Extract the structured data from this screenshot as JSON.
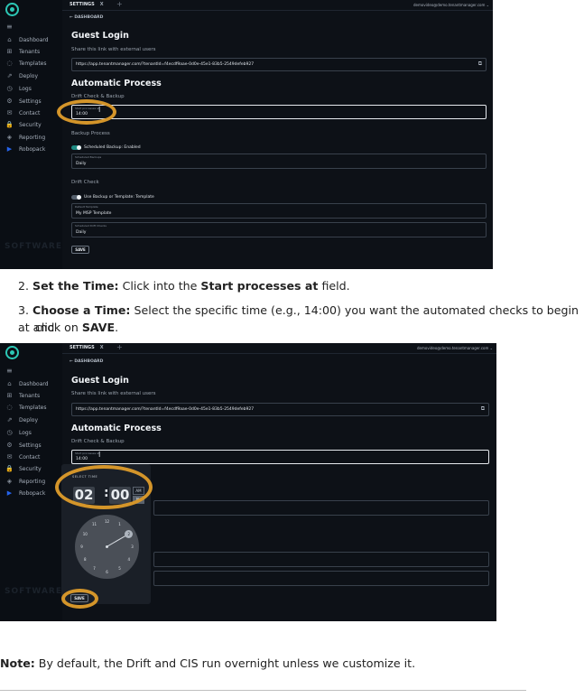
{
  "screenshot1": {
    "sidebar": {
      "brand": "SOFTWARE",
      "items": [
        {
          "label": "Dashboard",
          "icon": "home-icon",
          "glyph": "⌂"
        },
        {
          "label": "Tenants",
          "icon": "plus-square-icon",
          "glyph": "⊞"
        },
        {
          "label": "Templates",
          "icon": "template-icon",
          "glyph": "◌"
        },
        {
          "label": "Deploy",
          "icon": "deploy-icon",
          "glyph": "⇗"
        },
        {
          "label": "Logs",
          "icon": "logs-icon",
          "glyph": "◷"
        },
        {
          "label": "Settings",
          "icon": "gear-icon",
          "glyph": "⚙"
        },
        {
          "label": "Contact",
          "icon": "mail-icon",
          "glyph": "✉"
        },
        {
          "label": "Security",
          "icon": "lock-icon",
          "glyph": "🔒"
        },
        {
          "label": "Reporting",
          "icon": "reporting-icon",
          "glyph": "◈"
        },
        {
          "label": "Robopack",
          "icon": "play-icon",
          "glyph": "▶"
        }
      ]
    },
    "tab_label": "SETTINGS",
    "tab_close": "X",
    "new_tab": "+",
    "user_email": "demovideo@demo.tenantmanager.com",
    "breadcrumb": "← DASHBOARD",
    "guest_login": {
      "title": "Guest Login",
      "subtitle": "Share this link with external users",
      "link": "https://app.tenantmanager.com/?tenantId=f4ecdf9aae-0d0e-45e1-83b5-2549defeb927"
    },
    "automatic_process": {
      "title": "Automatic Process",
      "subtitle": "Drift Check & Backup",
      "start_label": "Start processes at",
      "start_value": "14:00"
    },
    "backup_process": {
      "title": "Backup Process",
      "toggle_label": "Scheduled Backup: Enabled",
      "field_label": "Scheduled Backups",
      "field_value": "Daily"
    },
    "drift_check": {
      "title": "Drift Check",
      "toggle_label": "Use Backup or Template: Template",
      "template_label": "Default Template",
      "template_value": "My MSP Template",
      "checks_label": "Scheduled Drift Checks",
      "checks_value": "Daily"
    },
    "save_label": "SAVE"
  },
  "steps": [
    {
      "number": "2.",
      "bold": "Set the Time:",
      "text1": " Click into the ",
      "bold2": "Start processes at",
      "text2": " field."
    },
    {
      "number": "3.",
      "bold": "Choose a Time:",
      "text1": " Select the specific time (e.g., 14:00) you want the automated checks to begin at and",
      "line2a": "click on ",
      "bold2": "SAVE",
      "line2b": "."
    }
  ],
  "screenshot2": {
    "select_time_label": "SELECT TIME",
    "hour": "02",
    "minute": "00",
    "am": "AM",
    "pm": "PM",
    "selected_period": "PM",
    "clock_numbers": [
      "12",
      "1",
      "2",
      "3",
      "4",
      "5",
      "6",
      "7",
      "8",
      "9",
      "10",
      "11"
    ],
    "selected_hour": "2"
  },
  "note": {
    "bold": "Note:",
    "text": " By default, the Drift and CIS run overnight unless we customize it."
  },
  "colors": {
    "app_bg": "#0d1117",
    "accent_teal": "#2cc7b5",
    "highlight_ring": "#d4952a"
  }
}
